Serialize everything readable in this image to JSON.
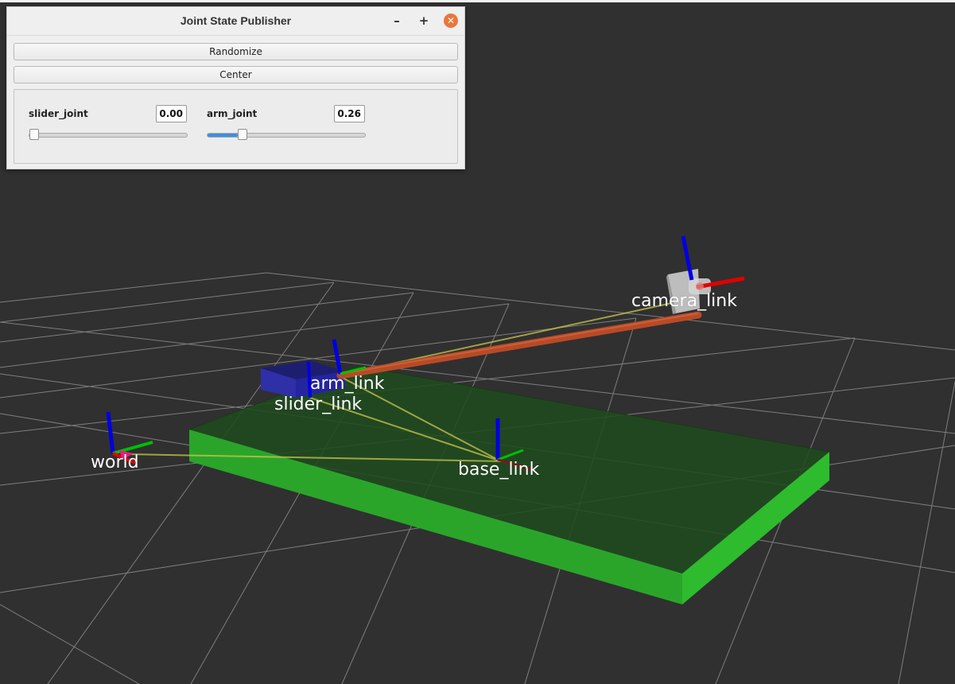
{
  "window": {
    "title": "Joint State Publisher",
    "minimize_glyph": "–",
    "maximize_glyph": "+",
    "close_glyph": "✕",
    "close_color": "#e9773a"
  },
  "buttons": {
    "randomize_label": "Randomize",
    "center_label": "Center"
  },
  "joints": [
    {
      "name": "slider_joint",
      "value": "0.00",
      "slider_fraction": 0.0
    },
    {
      "name": "arm_joint",
      "value": "0.26",
      "slider_fraction": 0.19
    }
  ],
  "viewport": {
    "background_color": "#303030",
    "frames": [
      {
        "id": "world",
        "label": "world"
      },
      {
        "id": "slider_link",
        "label": "slider_link"
      },
      {
        "id": "arm_link",
        "label": "arm_link"
      },
      {
        "id": "base_link",
        "label": "base_link"
      },
      {
        "id": "camera_link",
        "label": "camera_link"
      }
    ],
    "colors": {
      "base_plate": "#2aa52a",
      "slider_block": "#2a2aa8",
      "arm_rod": "#b84a26",
      "tf_link_line": "#c8c84a",
      "axis_x": "#e00000",
      "axis_y": "#00c000",
      "axis_z": "#0000e0"
    }
  }
}
